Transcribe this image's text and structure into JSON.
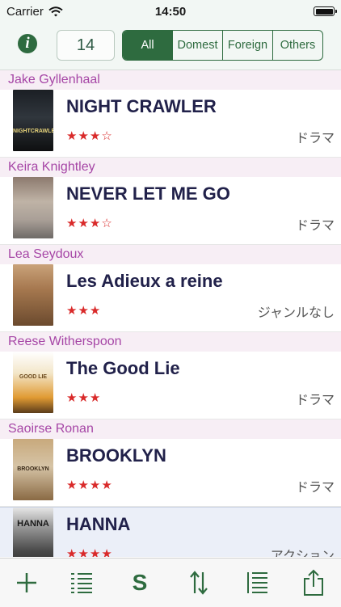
{
  "status_bar": {
    "carrier": "Carrier",
    "time": "14:50",
    "battery_level": 1.0
  },
  "toolbar": {
    "count": "14",
    "filter_options": [
      "All",
      "Domest",
      "Foreign",
      "Others"
    ],
    "selected_filter": "All"
  },
  "accent_color": "#2e6b3f",
  "section_header_color": "#a646a6",
  "star_color": "#d92a2a",
  "movies": [
    {
      "actor": "Jake Gyllenhaal",
      "title": "NIGHT CRAWLER",
      "rating": "★★★☆",
      "genre": "ドラマ",
      "poster_text": "NIGHTCRAWLER"
    },
    {
      "actor": "Keira Knightley",
      "title": "NEVER LET ME GO",
      "rating": "★★★☆",
      "genre": "ドラマ"
    },
    {
      "actor": "Lea Seydoux",
      "title": "Les Adieux a reine",
      "rating": "★★★",
      "genre": "ジャンルなし"
    },
    {
      "actor": "Reese Witherspoon",
      "title": "The Good Lie",
      "rating": "★★★",
      "genre": "ドラマ",
      "poster_text": "GOOD LIE"
    },
    {
      "actor": "Saoirse Ronan",
      "title": "BROOKLYN",
      "rating": "★★★★",
      "genre": "ドラマ",
      "poster_text": "BROOKLYN"
    },
    {
      "title": "HANNA",
      "rating": "★★★★",
      "genre": "アクション",
      "poster_text": "HANNA"
    }
  ],
  "tab_bar": [
    "plus-icon",
    "checklist-icon",
    "s-icon",
    "sort-icon",
    "numbered-list-icon",
    "share-icon"
  ],
  "tab_s_label": "S"
}
